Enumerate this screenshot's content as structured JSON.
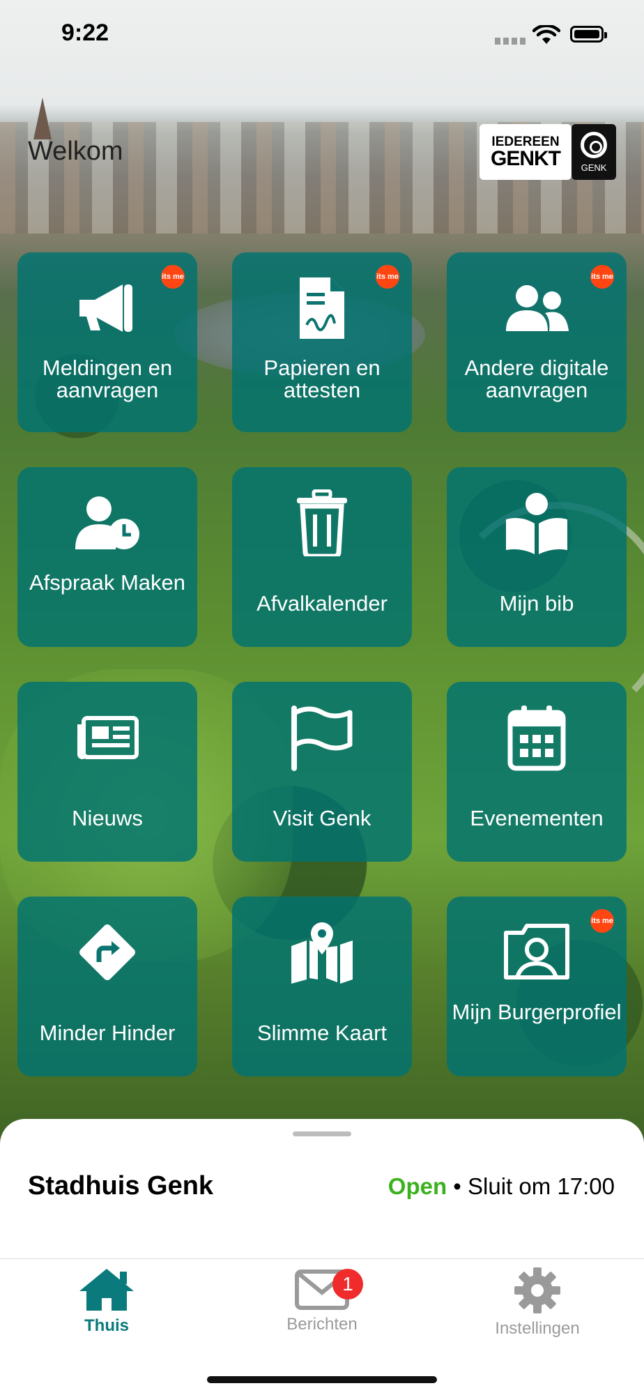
{
  "status_bar": {
    "time": "9:22"
  },
  "header": {
    "welcome": "Welkom",
    "logo_line1": "IEDEREEN",
    "logo_line2": "GENKT",
    "city_logo_text": "GENK"
  },
  "colors": {
    "tile": "#007370",
    "accent": "#0a7a7c",
    "open": "#3cb11e",
    "itsme_badge": "#ff4612",
    "notification_badge": "#ef2b2b"
  },
  "itsme_badge_text": "its me",
  "tiles": [
    {
      "label": "Meldingen en aanvragen",
      "icon": "megaphone-icon",
      "itsme": true
    },
    {
      "label": "Papieren en attesten",
      "icon": "document-signature-icon",
      "itsme": true
    },
    {
      "label": "Andere digitale aanvragen",
      "icon": "users-icon",
      "itsme": true
    },
    {
      "label": "Afspraak Maken",
      "icon": "user-clock-icon",
      "itsme": false
    },
    {
      "label": "Afvalkalender",
      "icon": "trash-icon",
      "itsme": false
    },
    {
      "label": "Mijn bib",
      "icon": "book-reader-icon",
      "itsme": false
    },
    {
      "label": "Nieuws",
      "icon": "newspaper-icon",
      "itsme": false
    },
    {
      "label": "Visit Genk",
      "icon": "flag-icon",
      "itsme": false
    },
    {
      "label": "Evenementen",
      "icon": "calendar-icon",
      "itsme": false
    },
    {
      "label": "Minder Hinder",
      "icon": "detour-sign-icon",
      "itsme": false
    },
    {
      "label": "Slimme Kaart",
      "icon": "map-marker-icon",
      "itsme": false
    },
    {
      "label": "Mijn Burgerprofiel",
      "icon": "profile-card-icon",
      "itsme": true
    }
  ],
  "sheet": {
    "title": "Stadhuis Genk",
    "open_label": "Open",
    "separator": "•",
    "closing": "Sluit om 17:00"
  },
  "tabbar": {
    "tabs": [
      {
        "label": "Thuis",
        "icon": "home-icon",
        "active": true
      },
      {
        "label": "Berichten",
        "icon": "envelope-icon",
        "active": false,
        "badge": "1"
      },
      {
        "label": "Instellingen",
        "icon": "gear-icon",
        "active": false
      }
    ]
  }
}
